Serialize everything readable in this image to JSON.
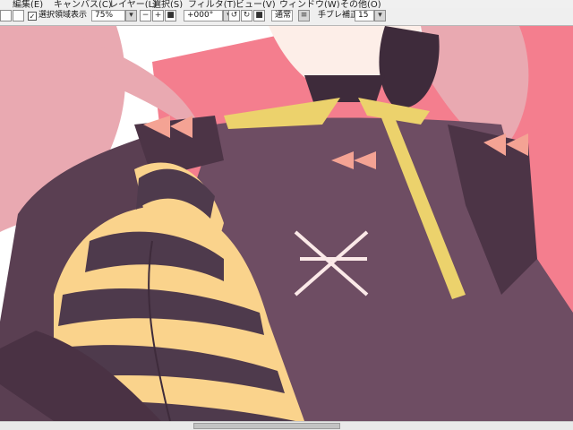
{
  "menu": [
    {
      "label": "編集(E)"
    },
    {
      "label": "キャンバス(C)"
    },
    {
      "label": "レイヤー(L)"
    },
    {
      "label": "選択(S)"
    },
    {
      "label": "フィルタ(T)"
    },
    {
      "label": "ビュー(V)"
    },
    {
      "label": "ウィンドウ(W)"
    },
    {
      "label": "その他(O)"
    }
  ],
  "toolbar": {
    "selection_checkbox_label": "選択領域表示",
    "selection_checked": true,
    "zoom_value": "75%",
    "angle_value": "+000°",
    "blend_mode": "通常",
    "stabilizer_label": "手ブレ補正",
    "stabilizer_value": "15"
  },
  "colors": {
    "background_pink": "#f47e8e",
    "hair_pink": "#e9a9b1",
    "dress_purple": "#6e4d63",
    "stocking_yellow": "#fad38c",
    "stocking_dark": "#4e3a4c",
    "ribbon_yellow": "#ecd26c",
    "bow_pink": "#f4a394"
  }
}
